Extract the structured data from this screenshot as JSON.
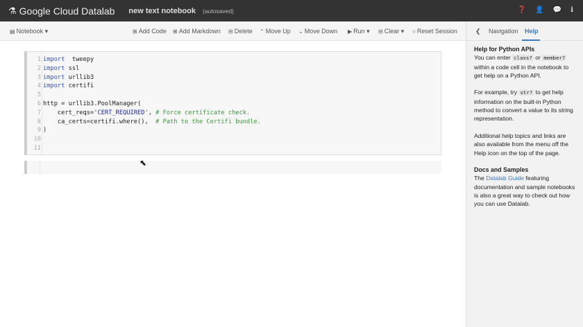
{
  "header": {
    "app_name": "Google Cloud Datalab",
    "notebook_title": "new text notebook",
    "save_status": "(autosaved)",
    "icons": [
      "help-icon",
      "user-icon",
      "chat-icon",
      "info-icon"
    ]
  },
  "toolbar": {
    "notebook": "Notebook",
    "add_code": "Add Code",
    "add_markdown": "Add Markdown",
    "delete": "Delete",
    "move_up": "Move Up",
    "move_down": "Move Down",
    "run": "Run",
    "clear": "Clear",
    "reset_session": "Reset Session"
  },
  "sidebar": {
    "tabs": [
      {
        "label": "Navigation"
      },
      {
        "label": "Help",
        "active": true
      }
    ],
    "help": {
      "heading1": "Help for Python APIs",
      "p1a": "You can enter ",
      "p1code1": "class?",
      "p1b": " or ",
      "p1code2": "member?",
      "p1c": " within a code cell in the notebook to get help on a Python API.",
      "p2a": "For example, try ",
      "p2code": "str?",
      "p2b": " to get help information on the built-in Python method to convert a value to its string representation.",
      "p3": "Additional help topics and links are also available from the menu off the Help icon on the top of the page.",
      "heading2": "Docs and Samples",
      "p4a": "The ",
      "p4link": "Datalab Guide",
      "p4b": " featuring documentation and sample notebooks is also a great way to check out how you can use Datalab."
    }
  },
  "cell": {
    "line_numbers": [
      "1",
      "2",
      "3",
      "4",
      "5",
      "6",
      "7",
      "8",
      "9",
      "10",
      "11"
    ],
    "lines": [
      [
        [
          "kw",
          "import"
        ],
        [
          "",
          "  tweepy"
        ]
      ],
      [
        [
          "kw",
          "import"
        ],
        [
          "",
          " ssl"
        ]
      ],
      [
        [
          "kw",
          "import"
        ],
        [
          "",
          " urllib3"
        ]
      ],
      [
        [
          "kw",
          "import"
        ],
        [
          "",
          " certifi"
        ]
      ],
      [],
      [
        [
          "",
          "http = urllib3.PoolManager("
        ]
      ],
      [
        [
          "",
          "    cert_reqs="
        ],
        [
          "st",
          "'CERT_REQUIRED'"
        ],
        [
          "",
          ", "
        ],
        [
          "cm",
          "# Force certificate check."
        ]
      ],
      [
        [
          "",
          "    ca_certs=certifi.where(),  "
        ],
        [
          "cm",
          "# Path to the Certifi bundle."
        ]
      ],
      [
        [
          "",
          ")"
        ]
      ],
      [],
      []
    ]
  },
  "colors": {
    "header_bg": "#333333",
    "accent": "#3a7bbf",
    "keyword": "#3557b5",
    "string": "#1d2a9e",
    "comment": "#3a9a3a"
  }
}
